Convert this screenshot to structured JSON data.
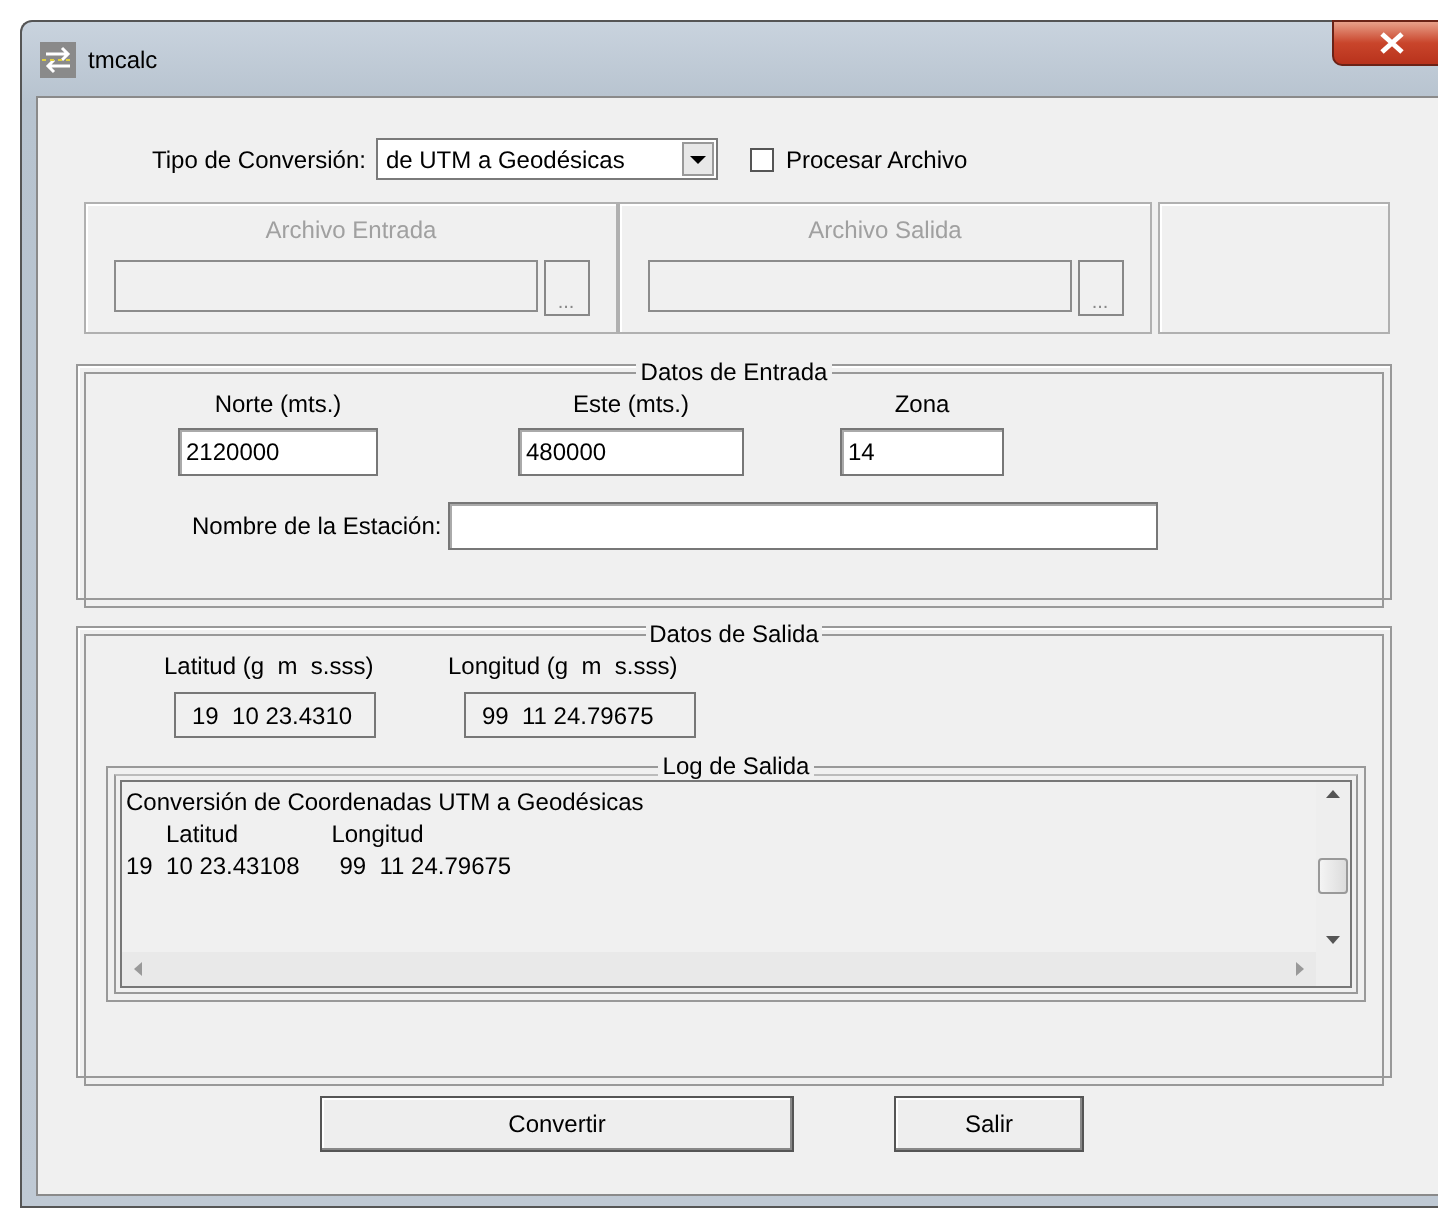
{
  "window": {
    "title": "tmcalc"
  },
  "conversion": {
    "label": "Tipo de Conversión:",
    "value": "de UTM a Geodésicas"
  },
  "process_file": {
    "label": "Procesar Archivo",
    "checked": false
  },
  "files": {
    "disabled": true,
    "items": [
      {
        "label": "Archivo Entrada",
        "button": "..."
      },
      {
        "label": "Archivo Salida",
        "button": "..."
      }
    ]
  },
  "input_data": {
    "title": "Datos de Entrada",
    "fields": [
      {
        "label": "Norte (mts.)",
        "value": "2120000"
      },
      {
        "label": "Este (mts.)",
        "value": "480000"
      },
      {
        "label": "Zona",
        "value": "14"
      }
    ],
    "station": {
      "label": "Nombre de la Estación:"
    }
  },
  "output_data": {
    "title": "Datos de Salida",
    "fields": [
      {
        "label": "Latitud (g  m  s.sss)",
        "value": "19  10 23.4310"
      },
      {
        "label": "Longitud (g  m  s.sss)",
        "value": "99  11 24.79675"
      }
    ],
    "log": {
      "title": "Log de Salida",
      "lines": [
        "Conversión de Coordenadas UTM a Geodésicas",
        "      Latitud              Longitud",
        "19  10 23.43108      99  11 24.79675"
      ]
    }
  },
  "buttons": [
    "Convertir",
    "Salir"
  ]
}
